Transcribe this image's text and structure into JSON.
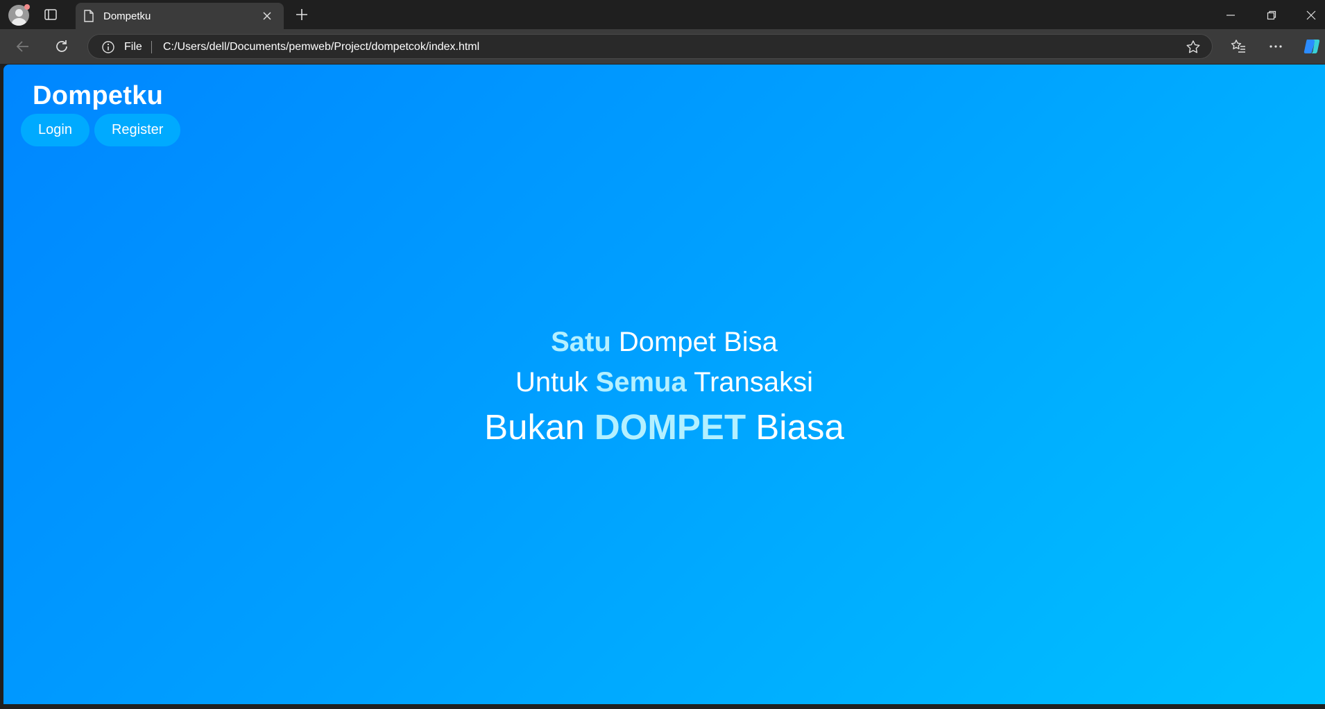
{
  "browser": {
    "tab": {
      "title": "Dompetku"
    },
    "address": {
      "scheme_label": "File",
      "url": "C:/Users/dell/Documents/pemweb/Project/dompetcok/index.html"
    },
    "icons": [
      "profile-icon",
      "tab-actions-icon",
      "page-icon",
      "close-icon",
      "plus-icon",
      "minimize-icon",
      "restore-icon",
      "back-icon",
      "reload-icon",
      "info-icon",
      "star-icon",
      "favorites-icon",
      "more-icon",
      "copilot-icon"
    ]
  },
  "page": {
    "brand": "Dompetku",
    "nav": {
      "login": "Login",
      "register": "Register"
    },
    "hero": {
      "line1": {
        "highlight": "Satu",
        "rest": " Dompet Bisa"
      },
      "line2": {
        "before": "Untuk ",
        "highlight": "Semua",
        "after": " Transaksi"
      },
      "line3": {
        "before": "Bukan ",
        "highlight": "DOMPET",
        "after": " Biasa"
      }
    },
    "colors": {
      "gradient_start": "#0086ff",
      "gradient_end": "#00c1ff",
      "button_bg": "#00aaff",
      "highlight_text": "#b4f0ff"
    }
  }
}
